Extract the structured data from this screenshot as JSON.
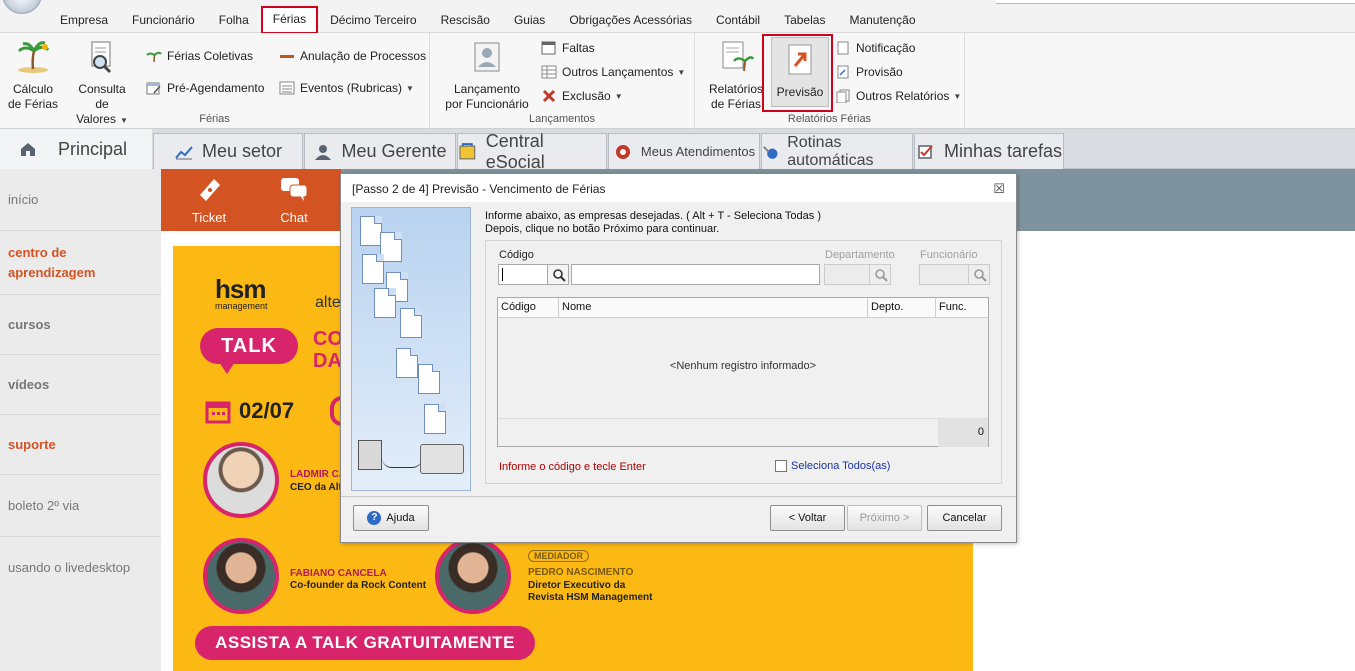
{
  "menu": [
    "Empresa",
    "Funcionário",
    "Folha",
    "Férias",
    "Décimo Terceiro",
    "Rescisão",
    "Guias",
    "Obrigações Acessórias",
    "Contábil",
    "Tabelas",
    "Manutenção"
  ],
  "menu_active": "Férias",
  "ribbon": {
    "ferias_group": {
      "label": "Férias",
      "calculo": "Cálculo\nde Férias",
      "consulta": "Consulta\nde Valores",
      "ferias_coletivas": "Férias Coletivas",
      "pre_agendamento": "Pré-Agendamento",
      "anulacao": "Anulação de Processos",
      "eventos": "Eventos (Rubricas)"
    },
    "lancamentos_group": {
      "label": "Lançamentos",
      "lancamento_funcionario": "Lançamento\npor Funcionário",
      "faltas": "Faltas",
      "outros_lancamentos": "Outros Lançamentos",
      "exclusao": "Exclusão"
    },
    "relatorios_group": {
      "label": "Relatórios Férias",
      "relatorios": "Relatórios\nde Férias",
      "previsao": "Previsão",
      "notificacao": "Notificação",
      "provisao": "Provisão",
      "outros_relatorios": "Outros Relatórios"
    }
  },
  "tabs": [
    "Principal",
    "Meu setor",
    "Meu Gerente",
    "Central eSocial",
    "Meus Atendimentos",
    "Rotinas automáticas",
    "Minhas tarefas"
  ],
  "sidebar": [
    "início",
    "centro de aprendizagem",
    "cursos",
    "vídeos",
    "suporte",
    "boleto 2º via",
    "usando o livedesktop"
  ],
  "quick": {
    "ticket": "Ticket",
    "chat": "Chat"
  },
  "banner": {
    "brand": "hsm",
    "brand_sub": "management",
    "partner": "alte",
    "talk": "TALK",
    "title_line1": "CO",
    "title_line2": "DA",
    "date": "02/07",
    "p1_name": "LADMIR CA",
    "p1_role": "CEO da Alte",
    "p2_name": "FABIANO CANCELA",
    "p2_role": "Co-founder da Rock Content",
    "mediator_tag": "MEDIADOR",
    "p3_name": "PEDRO NASCIMENTO",
    "p3_role1": "Diretor Executivo da",
    "p3_role2": "Revista HSM Management",
    "cta": "ASSISTA A TALK GRATUITAMENTE"
  },
  "dialog": {
    "title": "[Passo 2 de 4] Previsão - Vencimento de Férias",
    "close": "☒",
    "instruction1": "Informe abaixo, as empresas desejadas. ( Alt + T - Seleciona Todas )",
    "instruction2": "Depois, clique no botão Próximo para continuar.",
    "codigo_label": "Código",
    "departamento_label": "Departamento",
    "funcionario_label": "Funcionário",
    "codigo_value": "",
    "columns": [
      "Código",
      "Nome",
      "Depto.",
      "Func."
    ],
    "empty": "<Nenhum registro informado>",
    "count": "0",
    "hint": "Informe o código e tecle Enter",
    "select_all": "Seleciona Todos(as)",
    "help": "Ajuda",
    "back": "< Voltar",
    "next": "Próximo >",
    "cancel": "Cancelar"
  },
  "colors": {
    "accent_red": "#d0021b",
    "orange": "#d35322",
    "banner_yellow": "#fdb913",
    "magenta": "#d8246b"
  }
}
